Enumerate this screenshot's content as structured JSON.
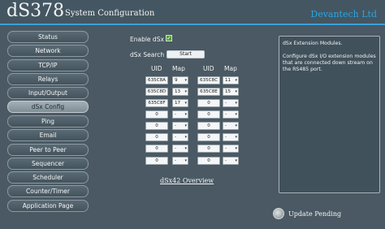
{
  "header": {
    "logo": "dS378",
    "subtitle": "System Configuration",
    "brand": "Devantech Ltd"
  },
  "sidebar": {
    "items": [
      {
        "label": "Status",
        "active": false
      },
      {
        "label": "Network",
        "active": false
      },
      {
        "label": "TCP/IP",
        "active": false
      },
      {
        "label": "Relays",
        "active": false
      },
      {
        "label": "Input/Output",
        "active": false
      },
      {
        "label": "dSx Config",
        "active": true
      },
      {
        "label": "Ping",
        "active": false
      },
      {
        "label": "Email",
        "active": false
      },
      {
        "label": "Peer to Peer",
        "active": false
      },
      {
        "label": "Sequencer",
        "active": false
      },
      {
        "label": "Scheduler",
        "active": false
      },
      {
        "label": "Counter/Timer",
        "active": false
      },
      {
        "label": "Application Page",
        "active": false
      }
    ]
  },
  "main": {
    "enable_label": "Enable dSx",
    "enable_checked": true,
    "search_label": "dSx Search",
    "start_label": "Start",
    "col_uid": "UID",
    "col_map": "Map",
    "left_rows": [
      {
        "uid": "635C8A",
        "map": "9"
      },
      {
        "uid": "635C8D",
        "map": "13"
      },
      {
        "uid": "635C8F",
        "map": "17"
      },
      {
        "uid": "0",
        "map": "-"
      },
      {
        "uid": "0",
        "map": "-"
      },
      {
        "uid": "0",
        "map": "-"
      },
      {
        "uid": "0",
        "map": "-"
      },
      {
        "uid": "0",
        "map": "-"
      }
    ],
    "right_rows": [
      {
        "uid": "635C8C",
        "map": "11"
      },
      {
        "uid": "635C8E",
        "map": "15"
      },
      {
        "uid": "0",
        "map": "-"
      },
      {
        "uid": "0",
        "map": "-"
      },
      {
        "uid": "0",
        "map": "-"
      },
      {
        "uid": "0",
        "map": "-"
      },
      {
        "uid": "0",
        "map": "-"
      },
      {
        "uid": "0",
        "map": "-"
      }
    ],
    "overview_link": "dSx42 Overview"
  },
  "help": {
    "title": "dSx Extension Modules.",
    "body": "Configure dSx I/O extension modules that are connected down stream on the RS485 port."
  },
  "footer": {
    "pending_label": "Update Pending"
  }
}
